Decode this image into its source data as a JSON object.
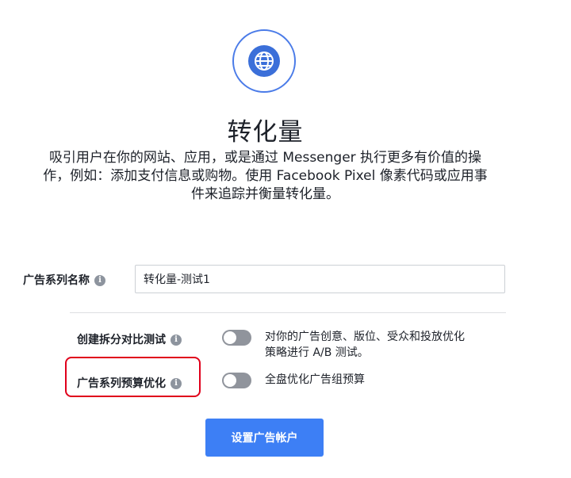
{
  "header": {
    "icon": "globe-icon",
    "title": "转化量",
    "description_lines": [
      "吸引用户在你的网站、应用，或是通过 Messenger 执行更多有价值的操",
      "作，例如：添加支付信息或购物。使用 Facebook Pixel 像素代码或应用事",
      "件来追踪并衡量转化量。"
    ]
  },
  "campaign_name": {
    "label": "广告系列名称",
    "value": "转化量-测试1"
  },
  "split_test": {
    "label": "创建拆分对比测试",
    "enabled": false,
    "description_lines": [
      "对你的广告创意、版位、受众和投放优化",
      "策略进行 A/B 测试。"
    ]
  },
  "budget_optimization": {
    "label": "广告系列预算优化",
    "enabled": false,
    "description": "全盘优化广告组预算"
  },
  "actions": {
    "setup_account_label": "设置广告帐户"
  },
  "colors": {
    "accent": "#3d7ff5",
    "toggle_off": "#90949c",
    "highlight": "#e0001b"
  }
}
